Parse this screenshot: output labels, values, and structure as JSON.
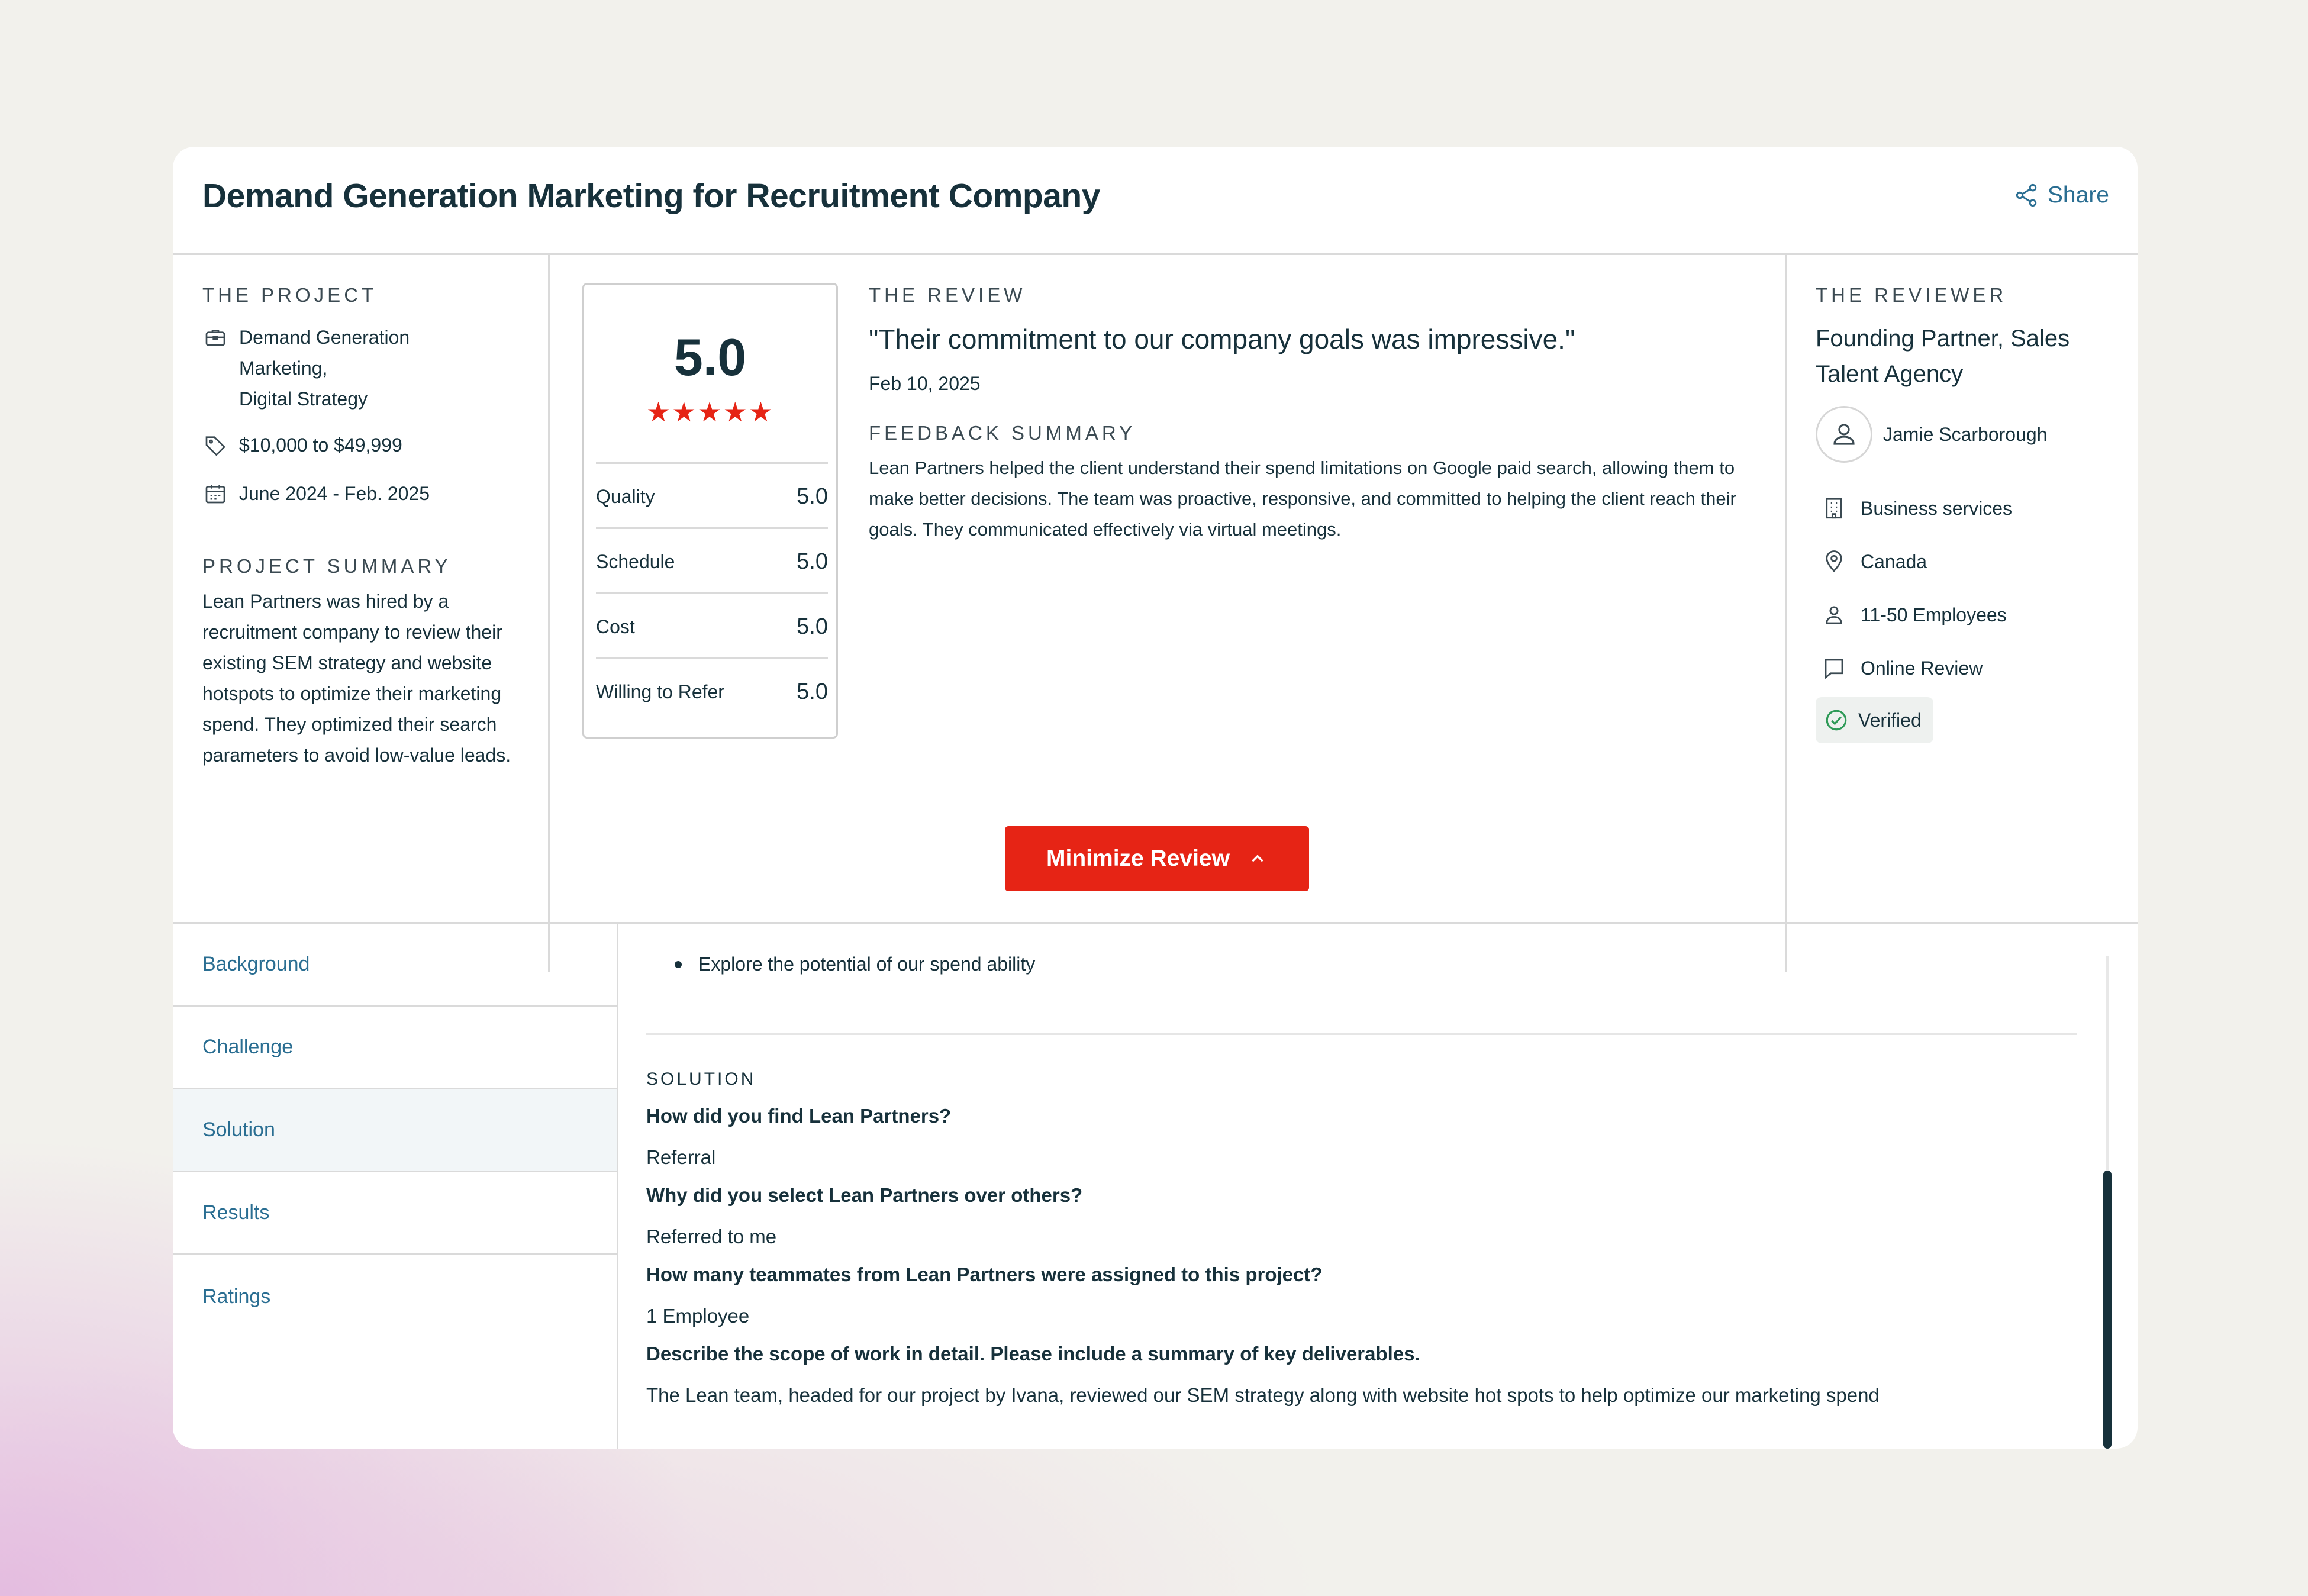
{
  "header": {
    "title": "Demand Generation Marketing for Recruitment Company",
    "share_label": "Share"
  },
  "project": {
    "heading": "THE PROJECT",
    "services_line1": "Demand Generation",
    "services_line2": "Marketing,",
    "services_line3": "Digital Strategy",
    "budget": "$10,000 to $49,999",
    "dates": "June 2024 - Feb. 2025",
    "summary_heading": "PROJECT SUMMARY",
    "summary": "Lean Partners was hired by a recruitment company to review their existing SEM strategy and website hotspots to optimize their marketing spend. They optimized their search parameters to avoid low-value leads."
  },
  "rating": {
    "overall": "5.0",
    "stars": "★★★★★",
    "rows": [
      {
        "label": "Quality",
        "value": "5.0"
      },
      {
        "label": "Schedule",
        "value": "5.0"
      },
      {
        "label": "Cost",
        "value": "5.0"
      },
      {
        "label": "Willing to Refer",
        "value": "5.0"
      }
    ]
  },
  "review": {
    "heading": "THE REVIEW",
    "quote": "\"Their commitment to our company goals was impressive.\"",
    "date": "Feb 10, 2025",
    "feedback_heading": "FEEDBACK SUMMARY",
    "feedback": "Lean Partners helped the client understand their spend limitations on Google paid search, allowing them to make better decisions. The team was proactive, responsive, and committed to helping the client reach their goals. They communicated effectively via virtual meetings."
  },
  "reviewer": {
    "heading": "THE REVIEWER",
    "title": "Founding Partner, Sales Talent Agency",
    "name": "Jamie Scarborough",
    "industry": "Business services",
    "location": "Canada",
    "size": "11-50 Employees",
    "review_type": "Online Review",
    "verified": "Verified"
  },
  "minimize_button": "Minimize Review",
  "nav": {
    "items": [
      {
        "label": "Background"
      },
      {
        "label": "Challenge"
      },
      {
        "label": "Solution"
      },
      {
        "label": "Results"
      },
      {
        "label": "Ratings"
      }
    ],
    "active": "Solution"
  },
  "details": {
    "bullet": "Explore the potential of our spend ability",
    "solution_heading": "SOLUTION",
    "qa": [
      {
        "q": "How did you find Lean Partners?",
        "a": "Referral"
      },
      {
        "q": "Why did you select Lean Partners over others?",
        "a": "Referred to me"
      },
      {
        "q": "How many teammates from Lean Partners were assigned to this project?",
        "a": "1 Employee"
      },
      {
        "q": "Describe the scope of work in detail. Please include a summary of key deliverables.",
        "a": "The Lean team, headed for our project by Ivana, reviewed our SEM strategy along with website hot spots to help optimize our marketing spend"
      }
    ]
  },
  "colors": {
    "accent": "#e62415",
    "link": "#2a6e92",
    "text": "#17313b"
  }
}
